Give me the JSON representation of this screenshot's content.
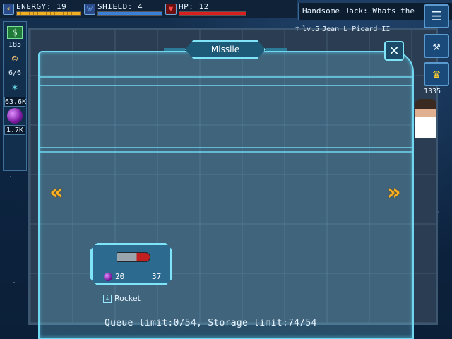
{
  "hud": {
    "energy": {
      "label": "ENERGY: 19",
      "level": 1.0
    },
    "shield": {
      "label": "SHIELD: 4",
      "level": 1.0
    },
    "hp": {
      "label": "HP: 12",
      "level": 1.0
    }
  },
  "chat": {
    "message": "Handsome Jäck: Whats the",
    "player_rank": "lv.5",
    "player_name": "Jean L Picard II"
  },
  "resources": {
    "cash": "185",
    "crew": "6/6",
    "gas": "63.6K",
    "mineral": "1.7K"
  },
  "right_panel": {
    "score": "1335"
  },
  "dialog": {
    "title": "Missile",
    "close_symbol": "✕",
    "prev_arrow": "«",
    "next_arrow": "»",
    "item": {
      "name": "Rocket",
      "cost": "20",
      "build_time": "37",
      "info_symbol": "i"
    },
    "limits_text": "Queue limit:0/54, Storage limit:74/54"
  },
  "colors": {
    "accent": "#6fd8f0",
    "arrow": "#ffb020",
    "hp": "#d82020",
    "energy": "#f0b020"
  },
  "icons": [
    "energy-icon",
    "shield-icon",
    "heart-icon",
    "cash-icon",
    "crew-icon",
    "crystal-icon",
    "gas-icon",
    "chat-icon",
    "build-icon",
    "trophy-icon",
    "close-icon",
    "chevron-left-icon",
    "chevron-right-icon",
    "info-icon",
    "rocket-icon"
  ]
}
